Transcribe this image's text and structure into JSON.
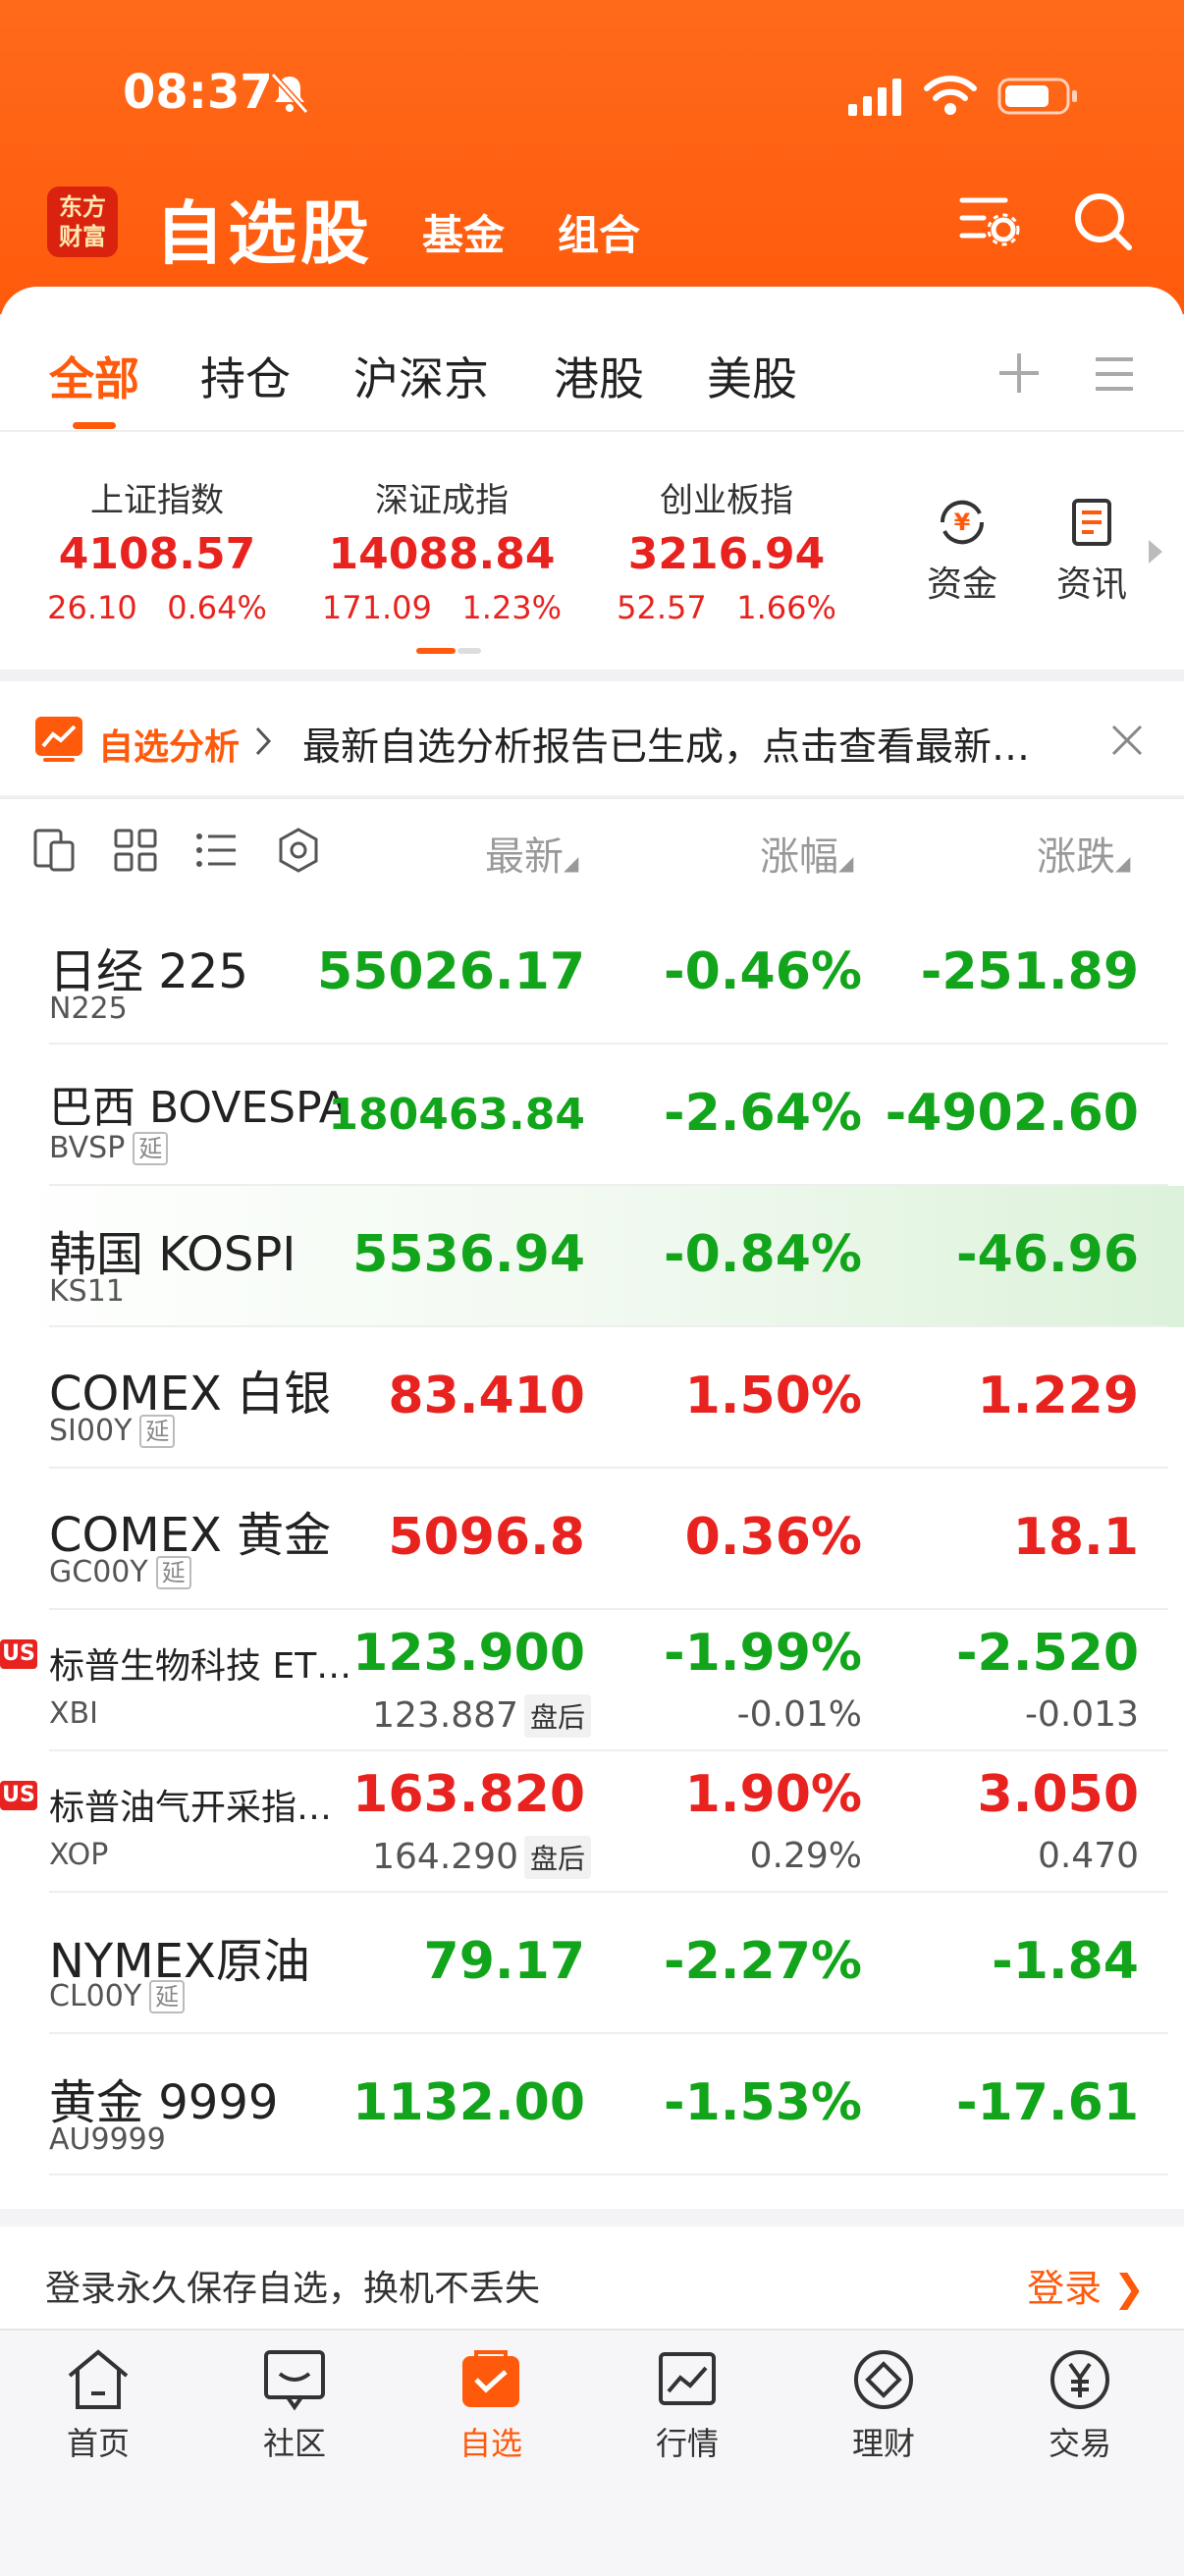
{
  "status": {
    "time": "08:37"
  },
  "header": {
    "logo_line1": "东方",
    "logo_line2": "财富",
    "title": "自选股",
    "tab_fund": "基金",
    "tab_combo": "组合"
  },
  "tabs": [
    "全部",
    "持仓",
    "沪深京",
    "港股",
    "美股"
  ],
  "indices": [
    {
      "name": "上证指数",
      "value": "4108.57",
      "chg": "26.10",
      "pct": "0.64%"
    },
    {
      "name": "深证成指",
      "value": "14088.84",
      "chg": "171.09",
      "pct": "1.23%"
    },
    {
      "name": "创业板指",
      "value": "3216.94",
      "chg": "52.57",
      "pct": "1.66%"
    }
  ],
  "quick": {
    "fund": "资金",
    "news": "资讯"
  },
  "banner": {
    "label": "自选分析",
    "text": "最新自选分析报告已生成，点击查看最新…"
  },
  "columns": {
    "latest": "最新",
    "pct": "涨幅",
    "chg": "涨跌"
  },
  "rows": [
    {
      "name": "日经 225",
      "code": "N225",
      "badge": "",
      "price": "55026.17",
      "pct": "-0.46%",
      "chg": "-251.89",
      "color": "green"
    },
    {
      "name": "巴西 BOVESPA",
      "code": "BVSP",
      "badge": "延",
      "price": "180463.84",
      "pct": "-2.64%",
      "chg": "-4902.60",
      "color": "green"
    },
    {
      "name": "韩国 KOSPI",
      "code": "KS11",
      "badge": "",
      "price": "5536.94",
      "pct": "-0.84%",
      "chg": "-46.96",
      "color": "green"
    },
    {
      "name": "COMEX 白银",
      "code": "SI00Y",
      "badge": "延",
      "price": "83.410",
      "pct": "1.50%",
      "chg": "1.229",
      "color": "red"
    },
    {
      "name": "COMEX 黄金",
      "code": "GC00Y",
      "badge": "延",
      "price": "5096.8",
      "pct": "0.36%",
      "chg": "18.1",
      "color": "red"
    },
    {
      "name": "标普生物科技 ET…",
      "code": "XBI",
      "us": "US",
      "price": "123.900",
      "pct": "-1.99%",
      "chg": "-2.520",
      "color": "green",
      "after_price": "123.887",
      "after_label": "盘后",
      "after_pct": "-0.01%",
      "after_chg": "-0.013"
    },
    {
      "name": "标普油气开采指…",
      "code": "XOP",
      "us": "US",
      "price": "163.820",
      "pct": "1.90%",
      "chg": "3.050",
      "color": "red",
      "after_price": "164.290",
      "after_label": "盘后",
      "after_pct": "0.29%",
      "after_chg": "0.470"
    },
    {
      "name": "NYMEX原油",
      "code": "CL00Y",
      "badge": "延",
      "price": "79.17",
      "pct": "-2.27%",
      "chg": "-1.84",
      "color": "green"
    },
    {
      "name": "黄金 9999",
      "code": "AU9999",
      "badge": "",
      "price": "1132.00",
      "pct": "-1.53%",
      "chg": "-17.61",
      "color": "green"
    }
  ],
  "login": {
    "text": "登录永久保存自选，换机不丢失",
    "button": "登录"
  },
  "nav": [
    "首页",
    "社区",
    "自选",
    "行情",
    "理财",
    "交易"
  ],
  "colors": {
    "accent": "#ff5a0c",
    "up": "#e8231f",
    "down": "#12a51b"
  }
}
